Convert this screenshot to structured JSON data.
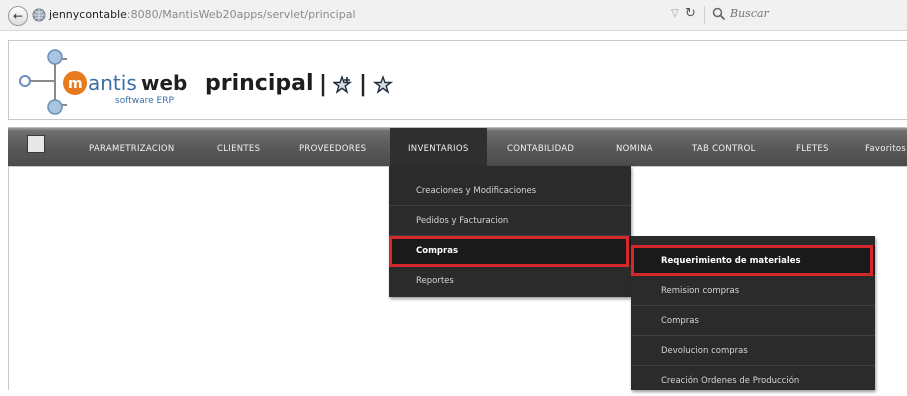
{
  "browser": {
    "url_host": "jennycontable",
    "url_rest": ":8080/MantisWeb20apps/servlet/principal",
    "search_placeholder": "Buscar",
    "back_icon": "back-arrow-icon",
    "reload_icon": "reload-icon"
  },
  "header": {
    "logo_text": "mantisweb",
    "logo_subtext": "software ERP",
    "page_title": "principal",
    "separator": "|",
    "add_favorite_icon": "star-plus-icon",
    "favorites_icon": "star-icon"
  },
  "menubar": {
    "home_icon": "home-icon",
    "items": [
      "PARAMETRIZACION",
      "CLIENTES",
      "PROVEEDORES",
      "INVENTARIOS",
      "CONTABILIDAD",
      "NOMINA",
      "TAB CONTROL",
      "FLETES",
      "Favoritos"
    ],
    "active_item": "INVENTARIOS"
  },
  "inventarios_menu": {
    "items": [
      "Creaciones y Modificaciones",
      "Pedidos y Facturacion",
      "Compras",
      "Reportes"
    ],
    "highlighted": "Compras"
  },
  "compras_submenu": {
    "items": [
      "Requerimiento de materiales",
      "Remision compras",
      "Compras",
      "Devolucion compras",
      "Creación Ordenes de Producción"
    ],
    "highlighted": "Requerimiento de materiales"
  },
  "colors": {
    "menubar": "#5a5a5a",
    "dropdown": "#2b2b2b",
    "highlight": "#d4282c",
    "logo_blue": "#3a6fa5",
    "logo_orange": "#e87a1e"
  }
}
